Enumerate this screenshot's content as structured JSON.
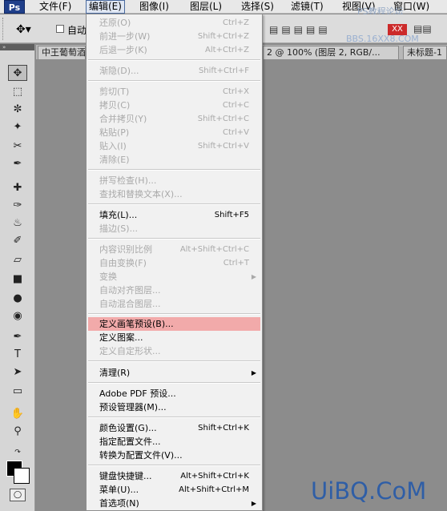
{
  "app": {
    "logo_text": "Ps"
  },
  "menubar": {
    "items": [
      {
        "label": "文件(F)"
      },
      {
        "label": "编辑(E)"
      },
      {
        "label": "图像(I)"
      },
      {
        "label": "图层(L)"
      },
      {
        "label": "选择(S)"
      },
      {
        "label": "滤镜(T)"
      },
      {
        "label": "视图(V)"
      },
      {
        "label": "窗口(W)"
      }
    ],
    "watermark": "PS教程论坛"
  },
  "optionbar": {
    "auto_label": "自动",
    "bbs_watermark": "BBS.16XX8.COM",
    "xx_badge": "XX"
  },
  "tabs": [
    {
      "label": "中王葡萄酒"
    },
    {
      "label": "2 @ 100% (图层 2, RGB/..."
    },
    {
      "label": "未标题-1"
    }
  ],
  "edit_menu": {
    "items": [
      {
        "label": "还原(O)",
        "shortcut": "Ctrl+Z",
        "disabled": true
      },
      {
        "label": "前进一步(W)",
        "shortcut": "Shift+Ctrl+Z",
        "disabled": true
      },
      {
        "label": "后退一步(K)",
        "shortcut": "Alt+Ctrl+Z",
        "disabled": true
      },
      {
        "label": "渐隐(D)...",
        "shortcut": "Shift+Ctrl+F",
        "disabled": true
      },
      {
        "label": "剪切(T)",
        "shortcut": "Ctrl+X",
        "disabled": true
      },
      {
        "label": "拷贝(C)",
        "shortcut": "Ctrl+C",
        "disabled": true
      },
      {
        "label": "合并拷贝(Y)",
        "shortcut": "Shift+Ctrl+C",
        "disabled": true
      },
      {
        "label": "粘贴(P)",
        "shortcut": "Ctrl+V",
        "disabled": true
      },
      {
        "label": "贴入(I)",
        "shortcut": "Shift+Ctrl+V",
        "disabled": true
      },
      {
        "label": "清除(E)",
        "shortcut": "",
        "disabled": true
      },
      {
        "label": "拼写检查(H)...",
        "shortcut": "",
        "disabled": true
      },
      {
        "label": "查找和替换文本(X)...",
        "shortcut": "",
        "disabled": true
      },
      {
        "label": "填充(L)...",
        "shortcut": "Shift+F5",
        "disabled": false
      },
      {
        "label": "描边(S)...",
        "shortcut": "",
        "disabled": true
      },
      {
        "label": "内容识别比例",
        "shortcut": "Alt+Shift+Ctrl+C",
        "disabled": true
      },
      {
        "label": "自由变换(F)",
        "shortcut": "Ctrl+T",
        "disabled": true
      },
      {
        "label": "变换",
        "shortcut": "",
        "disabled": true,
        "submenu": true
      },
      {
        "label": "自动对齐图层...",
        "shortcut": "",
        "disabled": true
      },
      {
        "label": "自动混合图层...",
        "shortcut": "",
        "disabled": true
      },
      {
        "label": "定义画笔预设(B)...",
        "shortcut": "",
        "disabled": false,
        "highlighted": true
      },
      {
        "label": "定义图案...",
        "shortcut": "",
        "disabled": false
      },
      {
        "label": "定义自定形状...",
        "shortcut": "",
        "disabled": true
      },
      {
        "label": "清理(R)",
        "shortcut": "",
        "disabled": false,
        "submenu": true
      },
      {
        "label": "Adobe PDF 预设...",
        "shortcut": "",
        "disabled": false
      },
      {
        "label": "预设管理器(M)...",
        "shortcut": "",
        "disabled": false
      },
      {
        "label": "颜色设置(G)...",
        "shortcut": "Shift+Ctrl+K",
        "disabled": false
      },
      {
        "label": "指定配置文件...",
        "shortcut": "",
        "disabled": false
      },
      {
        "label": "转换为配置文件(V)...",
        "shortcut": "",
        "disabled": false
      },
      {
        "label": "键盘快捷键...",
        "shortcut": "Alt+Shift+Ctrl+K",
        "disabled": false
      },
      {
        "label": "菜单(U)...",
        "shortcut": "Alt+Shift+Ctrl+M",
        "disabled": false
      },
      {
        "label": "首选项(N)",
        "shortcut": "",
        "disabled": false,
        "submenu": true
      }
    ]
  },
  "site_logo": "UiBQ.CoM"
}
